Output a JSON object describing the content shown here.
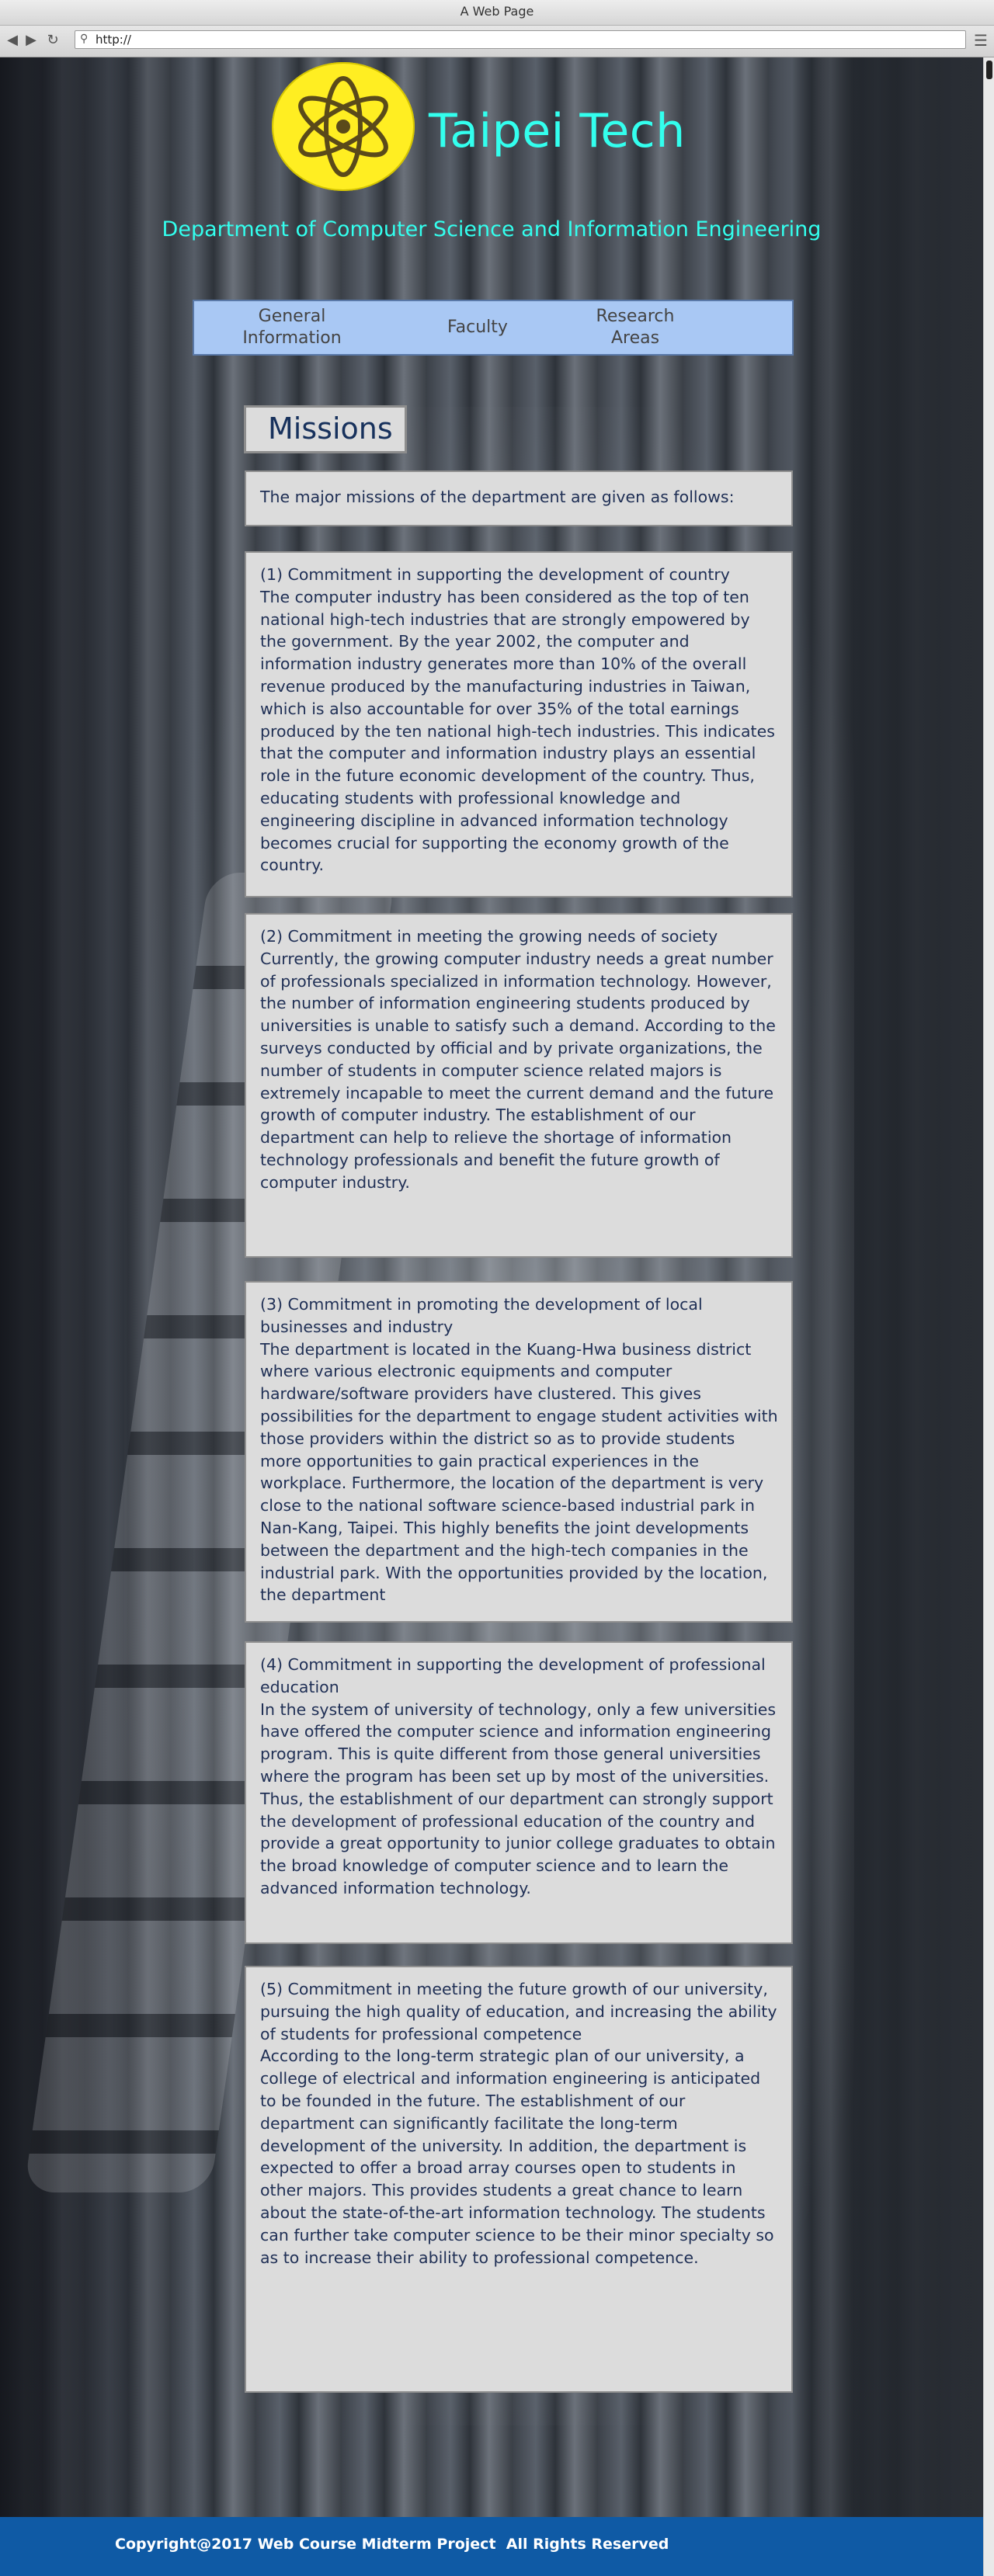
{
  "browser": {
    "window_title": "A Web Page",
    "url": "http://",
    "back_icon": "arrow-left-icon",
    "forward_icon": "arrow-right-icon",
    "reload_icon": "reload-icon",
    "menu_icon": "hamburger-menu-icon"
  },
  "header": {
    "logo_icon": "atom-icon",
    "site_title": "Taipei Tech",
    "department": "Department of Computer Science and Information Engineering",
    "accent_color": "#33ffee",
    "logo_color": "#ffee22"
  },
  "nav": {
    "items": [
      {
        "label": "General Information"
      },
      {
        "label": "Faculty"
      },
      {
        "label": "Research Areas"
      }
    ]
  },
  "main": {
    "section_title": "Missions",
    "intro": "The major missions of the department are given as follows:",
    "missions": [
      {
        "heading": "(1) Commitment in supporting the development of country",
        "body": "The computer industry has been considered as the top of ten national high-tech industries that are strongly empowered by the government. By the year 2002, the computer and information industry generates more than 10% of the overall revenue produced by the manufacturing industries in Taiwan, which is also accountable for over 35% of the total earnings produced by the ten national high-tech industries. This indicates that the computer and information industry plays an essential role in the future economic development of the country. Thus, educating students with professional knowledge and engineering discipline in advanced information technology becomes crucial for supporting the economy growth of the country."
      },
      {
        "heading": "(2) Commitment in meeting the growing needs of society",
        "body": "Currently, the growing computer industry needs a great number of professionals specialized in information technology. However, the number of information engineering students produced by universities is unable to satisfy such a demand. According to the surveys conducted by official and by private organizations, the number of students in computer science related majors is extremely incapable to meet the current demand and the future growth of computer industry. The establishment of our department can help to relieve the shortage of information technology professionals and benefit the future growth of computer industry."
      },
      {
        "heading": "(3) Commitment in promoting the development of local businesses and industry",
        "body": "The department is located in the Kuang-Hwa business district where various electronic equipments and computer hardware/software providers have clustered. This gives possibilities for the department to engage student activities with those providers within the district so as to provide students more opportunities to gain practical experiences in the workplace. Furthermore, the location of the department is very close to the national software science-based industrial park in Nan-Kang, Taipei. This highly benefits the joint developments between the department and the high-tech companies in the industrial park. With the opportunities provided by the location, the department"
      },
      {
        "heading": "(4) Commitment in supporting the development of professional education",
        "body": "In the system of university of technology, only a few universities have offered the computer science and information engineering program. This is quite different from those general universities where the program has been set up by most of the universities. Thus, the establishment of our department can strongly support the development of professional education of the country and provide a great opportunity to junior college graduates to obtain the broad knowledge of computer science and to learn the advanced information technology."
      },
      {
        "heading": "(5) Commitment in meeting the future growth of our university, pursuing the high quality of education, and increasing the ability of students for professional competence",
        "body": "According to the long-term strategic plan of our university, a college of electrical and information engineering is anticipated to be founded in the future. The establishment of our department can significantly facilitate the long-term development of the university. In addition, the department is expected to offer a broad array courses open to students in other majors. This provides students a great chance to learn about the state-of-the-art information technology. The students can further take computer science to be their minor specialty so as to increase their ability to professional competence."
      }
    ]
  },
  "footer": {
    "copyright": "Copyright@2017 Web Course Midterm Project  All Rights Reserved",
    "background_color": "#0f5aa5"
  }
}
